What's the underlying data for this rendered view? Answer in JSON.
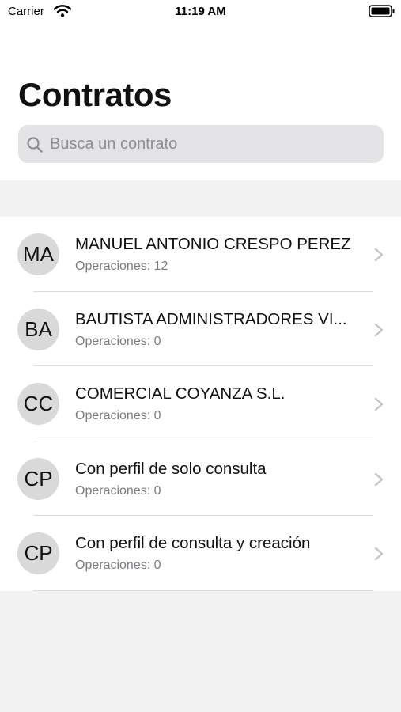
{
  "status_bar": {
    "carrier": "Carrier",
    "time": "11:19 AM"
  },
  "header": {
    "title": "Contratos"
  },
  "search": {
    "placeholder": "Busca un contrato",
    "value": ""
  },
  "contracts": [
    {
      "initials": "MA",
      "name": "MANUEL ANTONIO CRESPO PEREZ",
      "operations": "Operaciones: 12"
    },
    {
      "initials": "BA",
      "name": "BAUTISTA ADMINISTRADORES VI...",
      "operations": "Operaciones: 0"
    },
    {
      "initials": "CC",
      "name": "COMERCIAL COYANZA S.L.",
      "operations": "Operaciones: 0"
    },
    {
      "initials": "CP",
      "name": "Con perfil de solo consulta",
      "operations": "Operaciones: 0"
    },
    {
      "initials": "CP",
      "name": "Con perfil de consulta y creación",
      "operations": "Operaciones: 0"
    }
  ],
  "icons": {
    "wifi": "wifi-icon",
    "battery": "battery-icon",
    "search": "search-icon",
    "chevron": "chevron-right-icon"
  },
  "colors": {
    "background": "#f2f2f2",
    "search_field": "#e4e4e6",
    "avatar": "#d9d9d9",
    "secondary_text": "#7c7c80"
  }
}
